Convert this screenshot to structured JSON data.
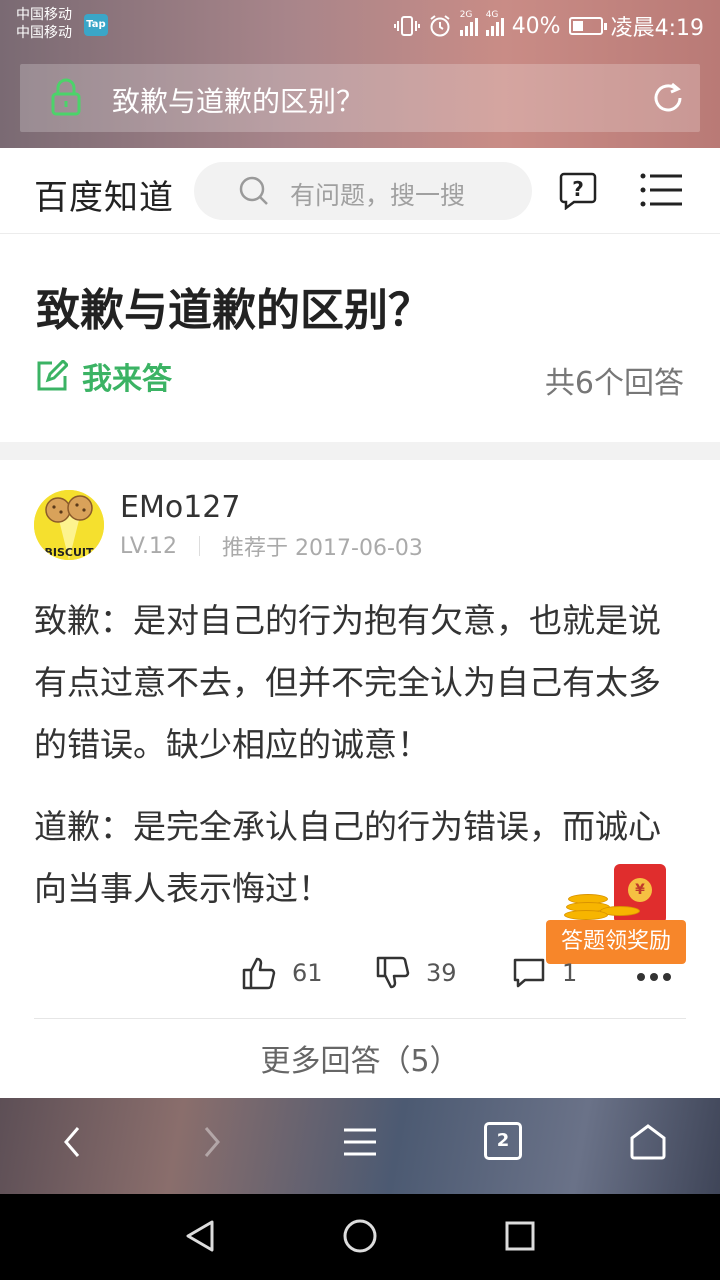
{
  "status_bar": {
    "carrier_1": "中国移动",
    "carrier_2": "中国移动",
    "tap_badge": "Tap",
    "network_1": "2G",
    "network_2": "4G",
    "battery_percent": "40%",
    "battery_level": 0.4,
    "time": "凌晨4:19"
  },
  "browser": {
    "url_title": "致歉与道歉的区别？",
    "lock_icon": "lock-icon",
    "refresh_icon": "refresh-icon",
    "toolbar": {
      "tab_count": "2",
      "icons": [
        "back-icon",
        "forward-icon",
        "menu-icon",
        "tabs-icon",
        "home-icon"
      ]
    }
  },
  "site": {
    "logo": "百度知道",
    "search_placeholder": "有问题，搜一搜"
  },
  "question": {
    "title": "致歉与道歉的区别？",
    "answer_button": "我来答",
    "answer_count": "共6个回答"
  },
  "answer": {
    "user": "EMo127",
    "level": "LV.12",
    "recommended": "推荐于 2017-06-03",
    "avatar_text": "BISCUIT",
    "paragraphs": [
      "致歉：是对自己的行为抱有欠意，也就是说有点过意不去，但并不完全认为自己有太多的错误。缺少相应的诚意！",
      "道歉：是完全承认自己的行为错误，而诚心向当事人表示悔过！"
    ],
    "likes": "61",
    "dislikes": "39",
    "comments": "1",
    "reward_label": "答题领奖励",
    "reward_symbol": "¥"
  },
  "more_answers": "更多回答（5）",
  "colors": {
    "brand_green": "#3bb364",
    "reward_orange": "#f7862a",
    "text_dark": "#222222"
  }
}
